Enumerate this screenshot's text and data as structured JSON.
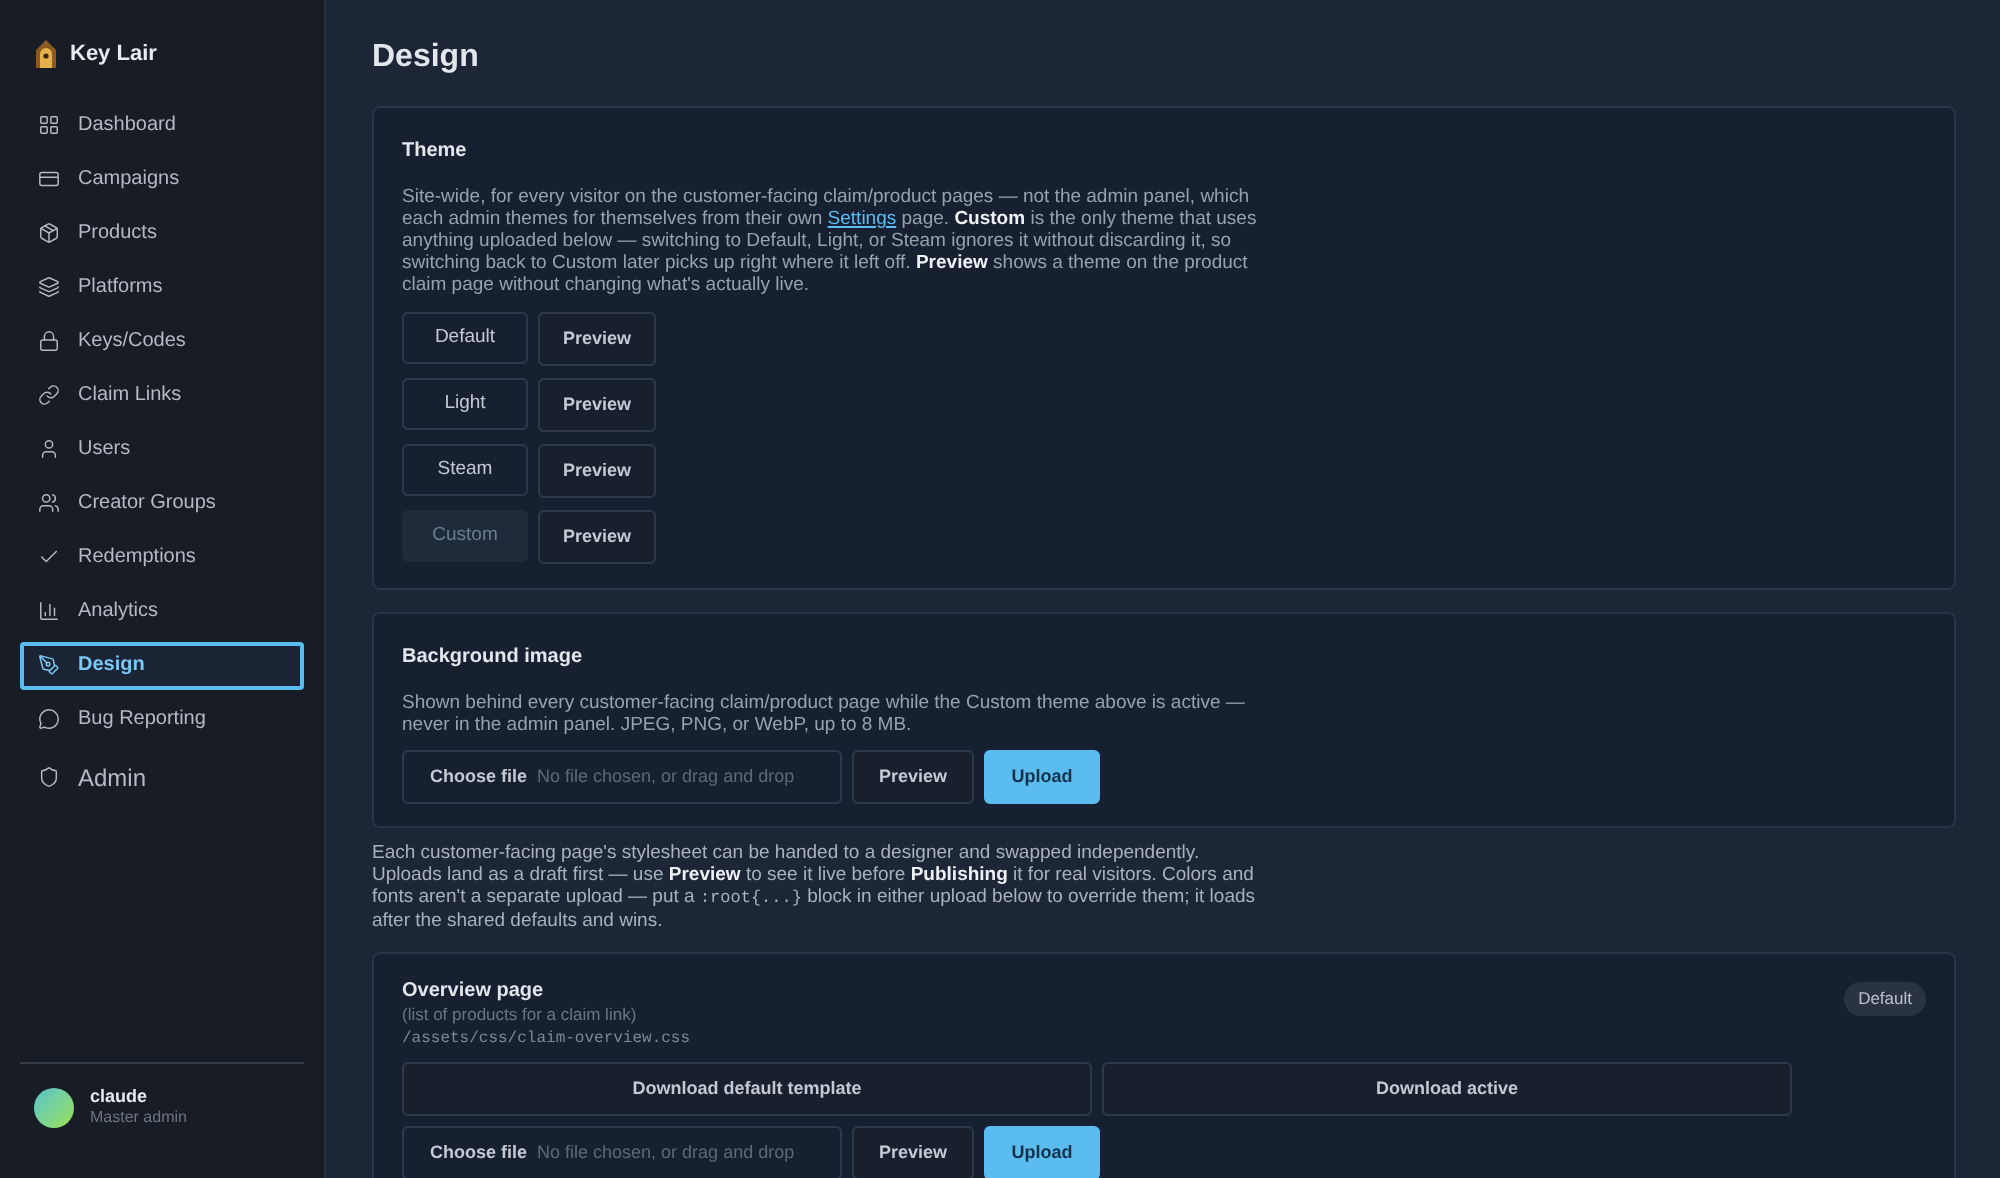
{
  "brand": {
    "name": "Key Lair"
  },
  "nav": [
    {
      "label": "Dashboard",
      "kind": "link",
      "selected": false
    },
    {
      "label": "Campaigns",
      "kind": "link",
      "selected": false
    },
    {
      "label": "Products",
      "kind": "link",
      "selected": false
    },
    {
      "label": "Platforms",
      "kind": "link",
      "selected": false
    },
    {
      "label": "Keys/Codes",
      "kind": "link",
      "selected": false
    },
    {
      "label": "Claim Links",
      "kind": "link",
      "selected": false
    },
    {
      "label": "Users",
      "kind": "link",
      "selected": false
    },
    {
      "label": "Creator Groups",
      "kind": "link",
      "selected": false
    },
    {
      "label": "Redemptions",
      "kind": "link",
      "selected": false
    },
    {
      "label": "Analytics",
      "kind": "link",
      "selected": false
    },
    {
      "label": "Design",
      "kind": "link",
      "selected": true
    },
    {
      "label": "Bug Reporting",
      "kind": "link",
      "selected": false
    },
    {
      "label": "Admin",
      "kind": "section",
      "selected": false
    }
  ],
  "user": {
    "name": "claude",
    "role": "Master admin"
  },
  "page_title": "Design",
  "theme_card": {
    "title": "Theme",
    "description": {
      "before": "Site-wide, for every visitor on the customer-facing claim/product pages — not the admin panel, which each admin themes for themselves from their own ",
      "link": "Settings",
      "after": " page. **Custom** is the only theme that uses anything uploaded below — switching to Default, Light, or Steam ignores it without discarding it, so switching back to Custom later picks up right where it left off. **Preview** shows a theme on the product claim page without changing what's actually live."
    },
    "themes": [
      {
        "label": "Default",
        "selected": false,
        "preview": "Preview"
      },
      {
        "label": "Light",
        "selected": false,
        "preview": "Preview"
      },
      {
        "label": "Steam",
        "selected": false,
        "preview": "Preview"
      },
      {
        "label": "Custom",
        "selected": true,
        "preview": "Preview"
      }
    ]
  },
  "background_card": {
    "title": "Background image",
    "description": "Shown behind every customer-facing claim/product page while the Custom theme above is active — never in the admin panel. JPEG, PNG, or WebP, up to 8 MB.",
    "file_button": "Choose file",
    "file_placeholder": "No file chosen, or drag and drop",
    "preview": "Preview",
    "upload": "Upload"
  },
  "stylesheet_note": {
    "before": "Each customer-facing page's stylesheet can be handed to a designer and swapped independently. Uploads land as a draft first — use **Preview** to see it live before **Publishing** it for real visitors. Colors and fonts aren't a separate upload — put a ",
    "code": ":root{...}",
    "after": " block in either upload below to override them; it loads after the shared defaults and wins."
  },
  "overview_card": {
    "title": "Overview page",
    "subtitle": "(list of products for a claim link)",
    "path": "/assets/css/claim-overview.css",
    "badge": "Default",
    "download_default": "Download default template",
    "download_active": "Download active",
    "file_button": "Choose file",
    "file_placeholder": "No file chosen, or drag and drop",
    "preview": "Preview",
    "upload": "Upload"
  }
}
